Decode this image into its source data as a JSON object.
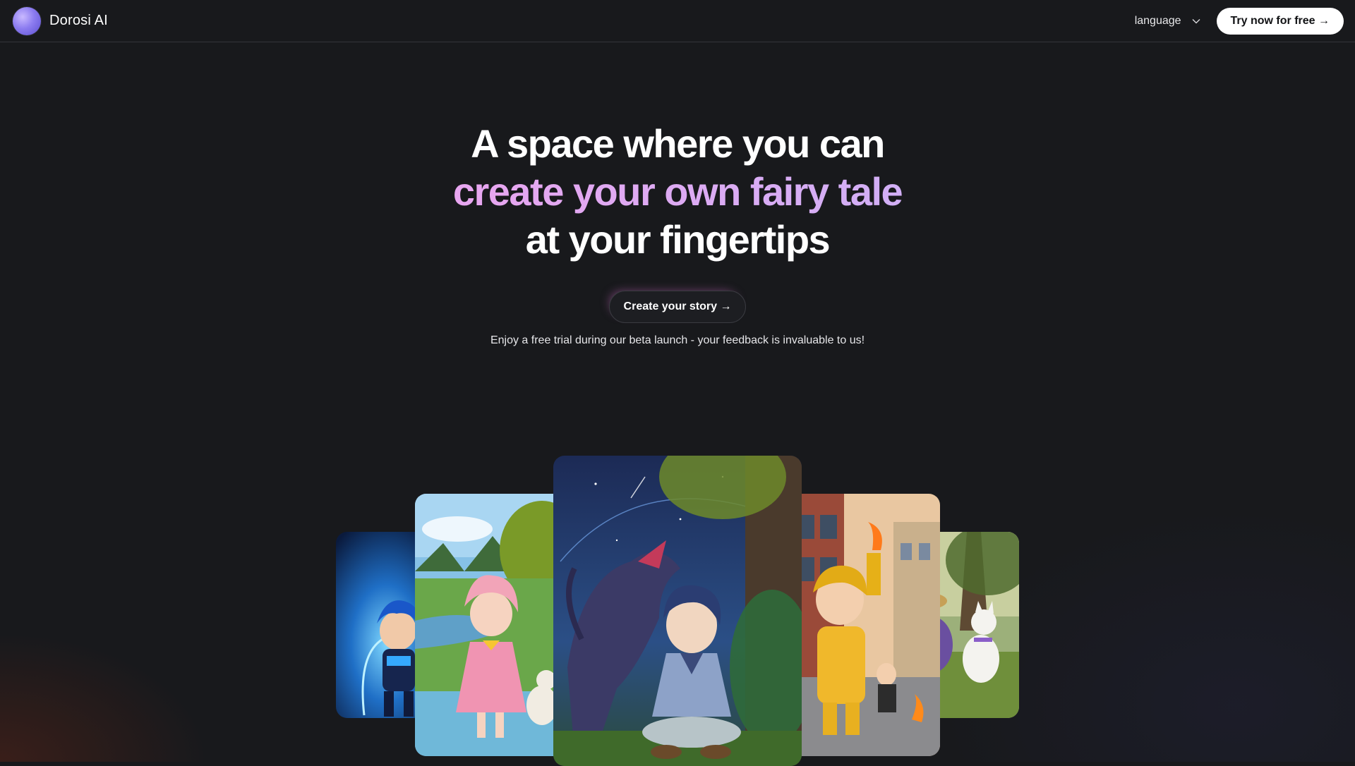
{
  "header": {
    "brand": "Dorosi AI",
    "language_label": "language",
    "try_button": "Try now for free →"
  },
  "hero": {
    "line1": "A space where you can",
    "line2": "create your own fairy tale",
    "line3": "at your fingertips",
    "cta": "Create your story →",
    "note": "Enjoy a free trial during our beta launch - your feedback is invaluable to us!"
  },
  "gallery": {
    "cards": [
      {
        "name": "blue-knight-boy"
      },
      {
        "name": "pink-girl-with-dog"
      },
      {
        "name": "boy-with-dragon"
      },
      {
        "name": "firefighter-boy"
      },
      {
        "name": "girl-with-white-dog"
      }
    ]
  },
  "colors": {
    "background": "#18191c",
    "accent_gradient_start": "#f1a7ea",
    "accent_gradient_end": "#c6b7fb"
  }
}
